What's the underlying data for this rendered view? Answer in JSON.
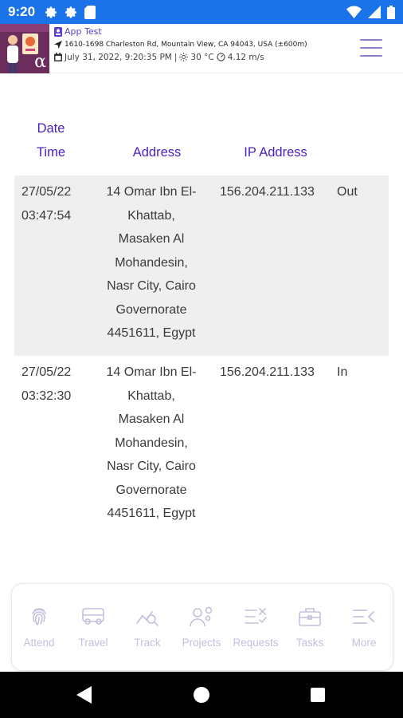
{
  "status_bar": {
    "time": "9:20",
    "left_icons": [
      "gear-icon",
      "gear-icon",
      "sd-card-icon"
    ],
    "right_icons": [
      "wifi-icon",
      "signal-icon",
      "battery-icon"
    ],
    "background": "#1a73e8"
  },
  "header": {
    "app_title": "App Test",
    "location": "1610-1698 Charleston Rd, Mountain View, CA 94043, USA (±600m)",
    "datetime": "July 31, 2022, 9:20:35 PM",
    "temperature": "30 °C",
    "wind": "4.12 m/s",
    "logo_text": "α",
    "accent": "#5b3fc4"
  },
  "table": {
    "columns": {
      "date": "Date",
      "time": "Time",
      "address": "Address",
      "ip": "IP Address"
    },
    "rows": [
      {
        "date": "27/05/22",
        "time": "03:47:54",
        "address": [
          "14 Omar Ibn El-",
          "Khattab,",
          "Masaken Al",
          "Mohandesin,",
          "Nasr City, Cairo",
          "Governorate",
          "4451611, Egypt"
        ],
        "ip": "156.204.211.133",
        "type": "Out"
      },
      {
        "date": "27/05/22",
        "time": "03:32:30",
        "address": [
          "14 Omar Ibn El-",
          "Khattab,",
          "Masaken Al",
          "Mohandesin,",
          "Nasr City, Cairo",
          "Governorate",
          "4451611, Egypt"
        ],
        "ip": "156.204.211.133",
        "type": "In"
      }
    ]
  },
  "bottom_nav": {
    "items": [
      {
        "label": "Attend",
        "icon": "fingerprint-icon"
      },
      {
        "label": "Travel",
        "icon": "bus-icon"
      },
      {
        "label": "Track",
        "icon": "track-icon"
      },
      {
        "label": "Projects",
        "icon": "projects-icon"
      },
      {
        "label": "Requests",
        "icon": "requests-icon"
      },
      {
        "label": "Tasks",
        "icon": "briefcase-icon"
      },
      {
        "label": "More",
        "icon": "more-icon"
      }
    ],
    "icon_color": "#c3c0dc"
  }
}
